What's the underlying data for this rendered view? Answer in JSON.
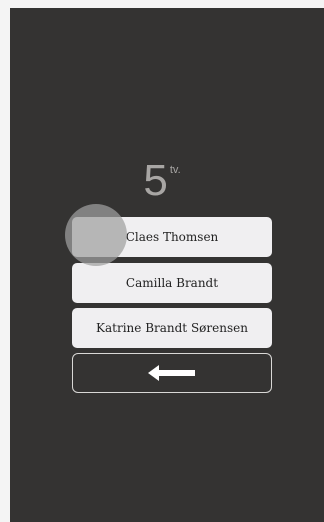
{
  "floor": {
    "number": "5",
    "suffix": "tv."
  },
  "residents": [
    {
      "name": "Claes Thomsen"
    },
    {
      "name": "Camilla Brandt"
    },
    {
      "name": "Katrine Brandt Sørensen"
    }
  ],
  "back_button": {
    "icon": "arrow-left-icon"
  },
  "colors": {
    "screen_background": "#343332",
    "page_background": "#f4f4f4",
    "button_background": "#f0eff1",
    "floor_text": "#a8a6a4",
    "back_border": "#d9d8d6"
  }
}
